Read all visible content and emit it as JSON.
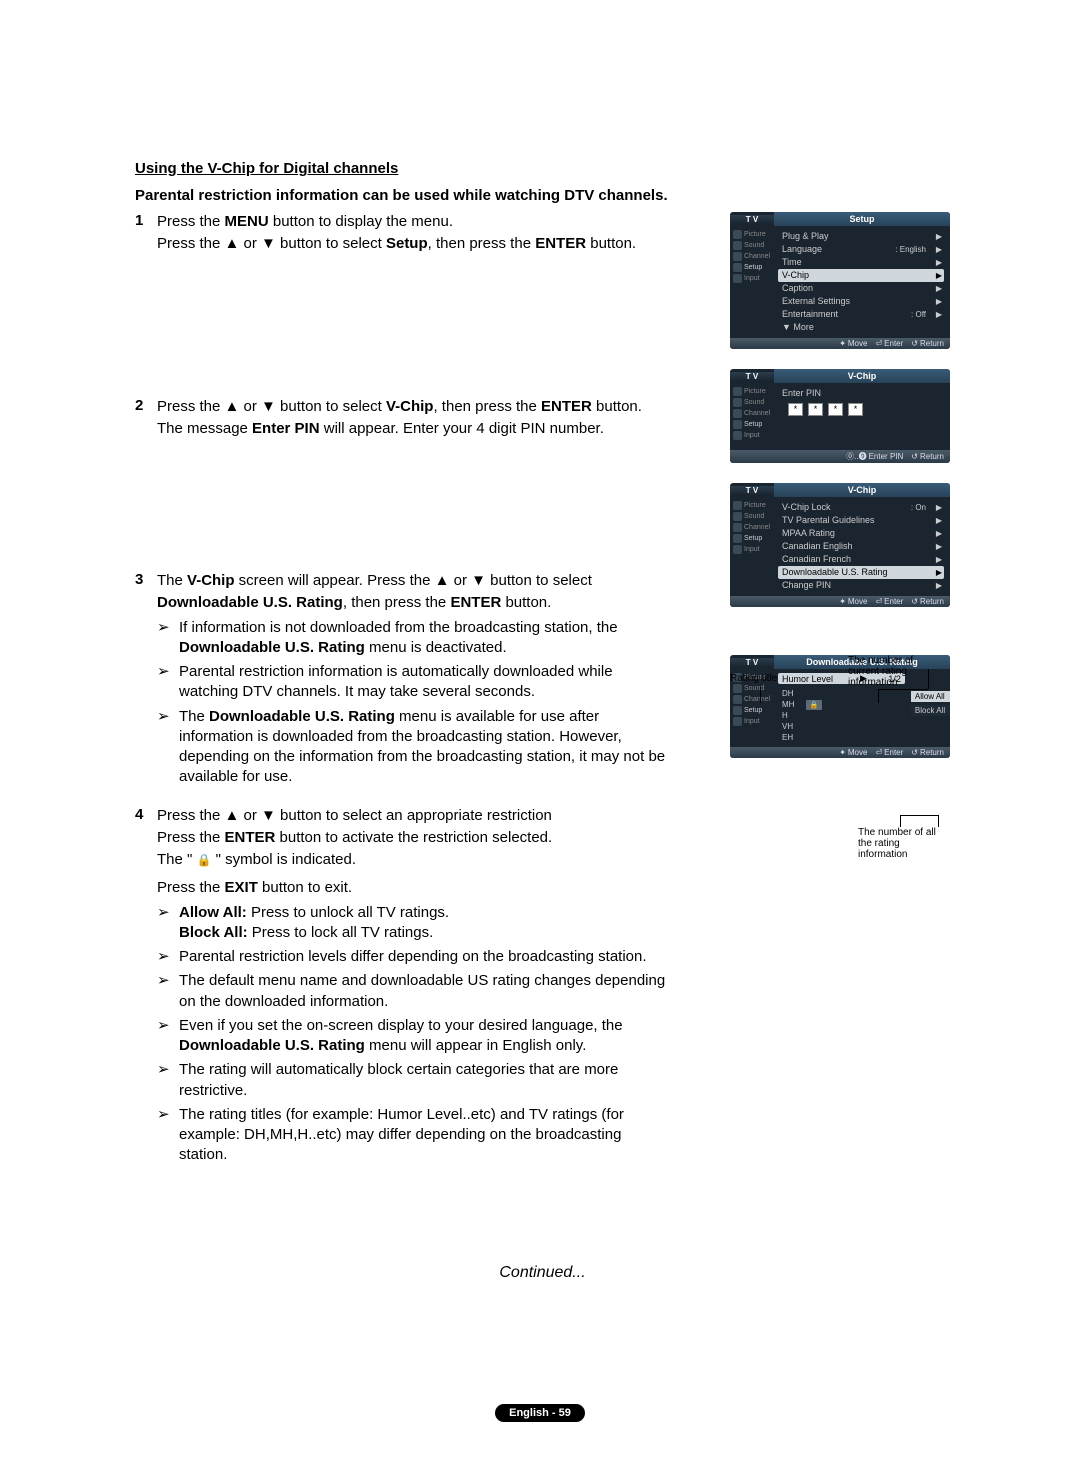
{
  "heading": "Using the V-Chip for Digital channels",
  "subheading": "Parental restriction information can be used while watching DTV channels.",
  "steps": {
    "n1": "1",
    "n2": "2",
    "n3": "3",
    "n4": "4",
    "s1a": "Press the ",
    "s1a_bold": "MENU",
    "s1a_end": " button to display the menu.",
    "s1b": "Press the ▲ or ▼ button to select ",
    "s1b_bold": "Setup",
    "s1b_mid": ", then press the ",
    "s1b_bold2": "ENTER",
    "s1b_end": " button.",
    "s2a": "Press the ▲ or ▼ button to select ",
    "s2a_bold": "V-Chip",
    "s2a_mid": ", then press the ",
    "s2a_bold2": "ENTER",
    "s2a_end": " button.",
    "s2b": "The message ",
    "s2b_bold": "Enter PIN",
    "s2b_end": " will appear. Enter your 4 digit PIN number.",
    "s3a": "The ",
    "s3a_bold": "V-Chip",
    "s3a_mid": " screen will appear. Press the ▲ or ▼ button to select ",
    "s3b_bold": "Downloadable U.S. Rating",
    "s3b_mid": ", then press the ",
    "s3b_bold2": "ENTER",
    "s3b_end": " button.",
    "s3_n1a": "If information is not downloaded from the broadcasting station, the ",
    "s3_n1b": "Downloadable U.S. Rating",
    "s3_n1c": " menu is deactivated.",
    "s3_n2": "Parental restriction information is automatically downloaded while watching DTV channels. It may take several seconds.",
    "s3_n3a": "The ",
    "s3_n3b": "Downloadable U.S. Rating",
    "s3_n3c": " menu is available for use after information is downloaded from the broadcasting station. However, depending on the information from the broadcasting station, it may not be available for use.",
    "s4a": "Press the ▲ or ▼ button to select an appropriate restriction",
    "s4b": "Press the ",
    "s4b_bold": "ENTER",
    "s4b_end": " button to activate the restriction selected.",
    "s4c_a": "The \" ",
    "s4c_b": " \" symbol is indicated.",
    "s4d": "Press the ",
    "s4d_bold": "EXIT",
    "s4d_end": " button to exit.",
    "s4_n1a": "Allow All:",
    "s4_n1b": " Press to unlock all TV ratings.",
    "s4_n1c": "Block All:",
    "s4_n1d": " Press to lock all TV ratings.",
    "s4_n2": "Parental restriction levels differ depending on the broadcasting station.",
    "s4_n3": "The default menu name and downloadable US rating changes depending on the downloaded information.",
    "s4_n4a": "Even if you set the on-screen display to your desired language, the ",
    "s4_n4b": "Downloadable U.S. Rating",
    "s4_n4c": " menu will appear in English only.",
    "s4_n5": "The rating will automatically block certain categories that are more restrictive.",
    "s4_n6": "The rating titles (for example: Humor Level..etc) and TV ratings (for example: DH,MH,H..etc) may differ depending on the broadcasting station."
  },
  "osd": {
    "tv": "T V",
    "setup": "Setup",
    "vchip": "V-Chip",
    "down_us": "Downloadable U.S. Rating",
    "side": {
      "picture": "Picture",
      "sound": "Sound",
      "channel": "Channel",
      "setup_s": "Setup",
      "input": "Input"
    },
    "setup_items": {
      "plug": "Plug & Play",
      "lang": "Language",
      "lang_val": ": English",
      "time": "Time",
      "vchip_i": "V-Chip",
      "caption": "Caption",
      "ext": "External Settings",
      "ent": "Entertainment",
      "ent_val": ": Off",
      "more": "▼ More"
    },
    "foot": {
      "move": "Move",
      "enter": "Enter",
      "return": "Return",
      "enterpin": "Enter PIN"
    },
    "pin_label": "Enter PIN",
    "pin_star": "*",
    "vchip_items": {
      "lock": "V-Chip Lock",
      "lock_val": ": On",
      "tv_par": "TV Parental Guidelines",
      "mpaa": "MPAA Rating",
      "can_en": "Canadian English",
      "can_fr": "Canadian French",
      "down": "Downloadable U.S. Rating",
      "change": "Change PIN"
    },
    "humor": {
      "label": "Humor Level",
      "play": "▶",
      "frac": "1/2",
      "dh": "DH",
      "mh": "MH",
      "h": "H",
      "vh": "VH",
      "eh": "EH",
      "allow": "Allow All",
      "block": "Block All"
    },
    "ann": {
      "rating_title": "Rating title",
      "num_current": "The number of current rating information",
      "num_all": "The number of all the rating information"
    }
  },
  "continued": "Continued...",
  "footer": "English - 59"
}
